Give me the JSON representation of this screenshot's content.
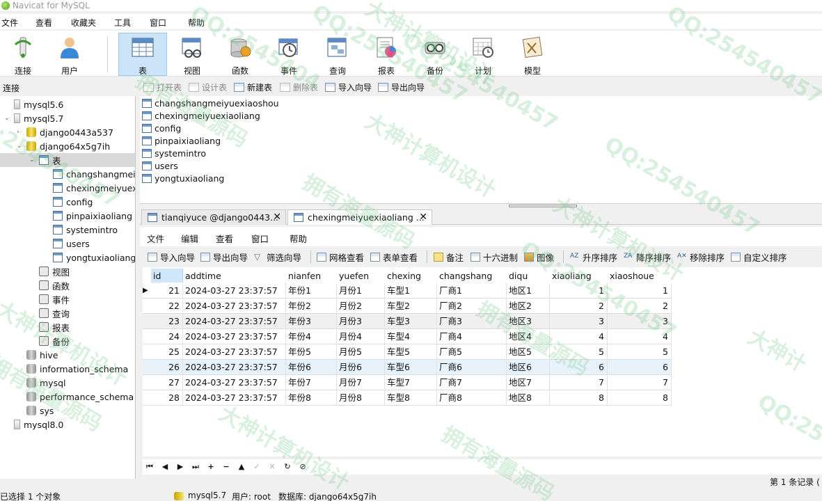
{
  "window": {
    "title": "Navicat for MySQL"
  },
  "menubar": [
    "文件",
    "查看",
    "收藏夹",
    "工具",
    "窗口",
    "帮助"
  ],
  "toolbar": [
    {
      "label": "连接",
      "icon": "connect-icon"
    },
    {
      "label": "用户",
      "icon": "user-icon"
    },
    {
      "label": "表",
      "icon": "table-icon",
      "active": true
    },
    {
      "label": "视图",
      "icon": "view-icon"
    },
    {
      "label": "函数",
      "icon": "function-icon"
    },
    {
      "label": "事件",
      "icon": "event-icon"
    },
    {
      "label": "查询",
      "icon": "query-icon"
    },
    {
      "label": "报表",
      "icon": "report-icon"
    },
    {
      "label": "备份",
      "icon": "backup-icon"
    },
    {
      "label": "计划",
      "icon": "schedule-icon"
    },
    {
      "label": "模型",
      "icon": "model-icon"
    }
  ],
  "objbar": {
    "connection_label": "连接",
    "buttons": [
      {
        "label": "打开表",
        "enabled": false
      },
      {
        "label": "设计表",
        "enabled": false
      },
      {
        "label": "新建表",
        "enabled": true
      },
      {
        "label": "删除表",
        "enabled": false
      },
      {
        "label": "导入向导",
        "enabled": true
      },
      {
        "label": "导出向导",
        "enabled": true
      }
    ]
  },
  "tree": [
    {
      "label": "mysql5.6",
      "level": 0,
      "icon": "server",
      "toggle": ""
    },
    {
      "label": "mysql5.7",
      "level": 0,
      "icon": "server",
      "toggle": "⌄"
    },
    {
      "label": "django0443a537",
      "level": 1,
      "icon": "db",
      "toggle": "›"
    },
    {
      "label": "django64x5g7ih",
      "level": 1,
      "icon": "db",
      "toggle": "⌄"
    },
    {
      "label": "表",
      "level": 2,
      "icon": "table",
      "toggle": "⌄",
      "selected": true
    },
    {
      "label": "changshangmeiyuexiaoshou",
      "level": 3,
      "icon": "table"
    },
    {
      "label": "chexingmeiyuexiaoliang",
      "level": 3,
      "icon": "table"
    },
    {
      "label": "config",
      "level": 3,
      "icon": "table"
    },
    {
      "label": "pinpaixiaoliang",
      "level": 3,
      "icon": "table"
    },
    {
      "label": "systemintro",
      "level": 3,
      "icon": "table"
    },
    {
      "label": "users",
      "level": 3,
      "icon": "table"
    },
    {
      "label": "yongtuxiaoliang",
      "level": 3,
      "icon": "table"
    },
    {
      "label": "视图",
      "level": 2,
      "icon": "misc"
    },
    {
      "label": "函数",
      "level": 2,
      "icon": "misc"
    },
    {
      "label": "事件",
      "level": 2,
      "icon": "misc"
    },
    {
      "label": "查询",
      "level": 2,
      "icon": "misc"
    },
    {
      "label": "报表",
      "level": 2,
      "icon": "misc"
    },
    {
      "label": "备份",
      "level": 2,
      "icon": "misc"
    },
    {
      "label": "hive",
      "level": 1,
      "icon": "db-grey"
    },
    {
      "label": "information_schema",
      "level": 1,
      "icon": "db-grey"
    },
    {
      "label": "mysql",
      "level": 1,
      "icon": "db-grey"
    },
    {
      "label": "performance_schema",
      "level": 1,
      "icon": "db-grey"
    },
    {
      "label": "sys",
      "level": 1,
      "icon": "db-grey"
    },
    {
      "label": "mysql8.0",
      "level": 0,
      "icon": "server"
    }
  ],
  "objects": [
    "changshangmeiyuexiaoshou",
    "chexingmeiyuexiaoliang",
    "config",
    "pinpaixiaoliang",
    "systemintro",
    "users",
    "yongtuxiaoliang"
  ],
  "tabs": [
    {
      "label": "tianqiyuce @django0443...",
      "active": false
    },
    {
      "label": "chexingmeiyuexiaoliang ...",
      "active": true
    }
  ],
  "inner_menu": [
    "文件",
    "编辑",
    "查看",
    "窗口",
    "帮助"
  ],
  "data_toolbar": [
    "导入向导",
    "导出向导",
    "筛选向导",
    "网格查看",
    "表单查看",
    "备注",
    "十六进制",
    "图像",
    "升序排序",
    "降序排序",
    "移除排序",
    "自定义排序"
  ],
  "grid": {
    "columns": [
      "id",
      "addtime",
      "nianfen",
      "yuefen",
      "chexing",
      "changshang",
      "diqu",
      "xiaoliang",
      "xiaoshoue"
    ],
    "rows": [
      [
        "21",
        "2024-03-27 23:37:57",
        "年份1",
        "月份1",
        "车型1",
        "厂商1",
        "地区1",
        "1",
        "1"
      ],
      [
        "22",
        "2024-03-27 23:37:57",
        "年份2",
        "月份2",
        "车型2",
        "厂商2",
        "地区2",
        "2",
        "2"
      ],
      [
        "23",
        "2024-03-27 23:37:57",
        "年份3",
        "月份3",
        "车型3",
        "厂商3",
        "地区3",
        "3",
        "3"
      ],
      [
        "24",
        "2024-03-27 23:37:57",
        "年份4",
        "月份4",
        "车型4",
        "厂商4",
        "地区4",
        "4",
        "4"
      ],
      [
        "25",
        "2024-03-27 23:37:57",
        "年份5",
        "月份5",
        "车型5",
        "厂商5",
        "地区5",
        "5",
        "5"
      ],
      [
        "26",
        "2024-03-27 23:37:57",
        "年份6",
        "月份6",
        "车型6",
        "厂商6",
        "地区6",
        "6",
        "6"
      ],
      [
        "27",
        "2024-03-27 23:37:57",
        "年份7",
        "月份7",
        "车型7",
        "厂商7",
        "地区7",
        "7",
        "7"
      ],
      [
        "28",
        "2024-03-27 23:37:57",
        "年份8",
        "月份8",
        "车型8",
        "厂商8",
        "地区8",
        "8",
        "8"
      ]
    ]
  },
  "navbar": [
    "⏮",
    "◀",
    "▶",
    "⏭",
    "+",
    "−",
    "▲",
    "✓",
    "✕",
    "↻",
    "⊘"
  ],
  "page_info": "第 1 条记录 (",
  "status": {
    "selection": "已选择 1 个对象",
    "connection": "mysql5.7",
    "user": "用户: root",
    "database": "数据库: django64x5g7ih"
  },
  "watermarks": [
    "QQ:2545404",
    "大神计算机设计",
    "QQ:254540457",
    "拥有海量源码",
    "QQ:254540457",
    "大神计算机设计",
    "拥有海量源码",
    "QQ:254540457",
    "大神计算机设计",
    "QQ:254540457",
    "拥有海量源码",
    "QQ:254540457",
    "大神计算机设计",
    "拥有海量源码",
    "QQ:254540457",
    "大神计算机设计",
    "拥有海量源码",
    "QQ:25454",
    "大神计"
  ]
}
